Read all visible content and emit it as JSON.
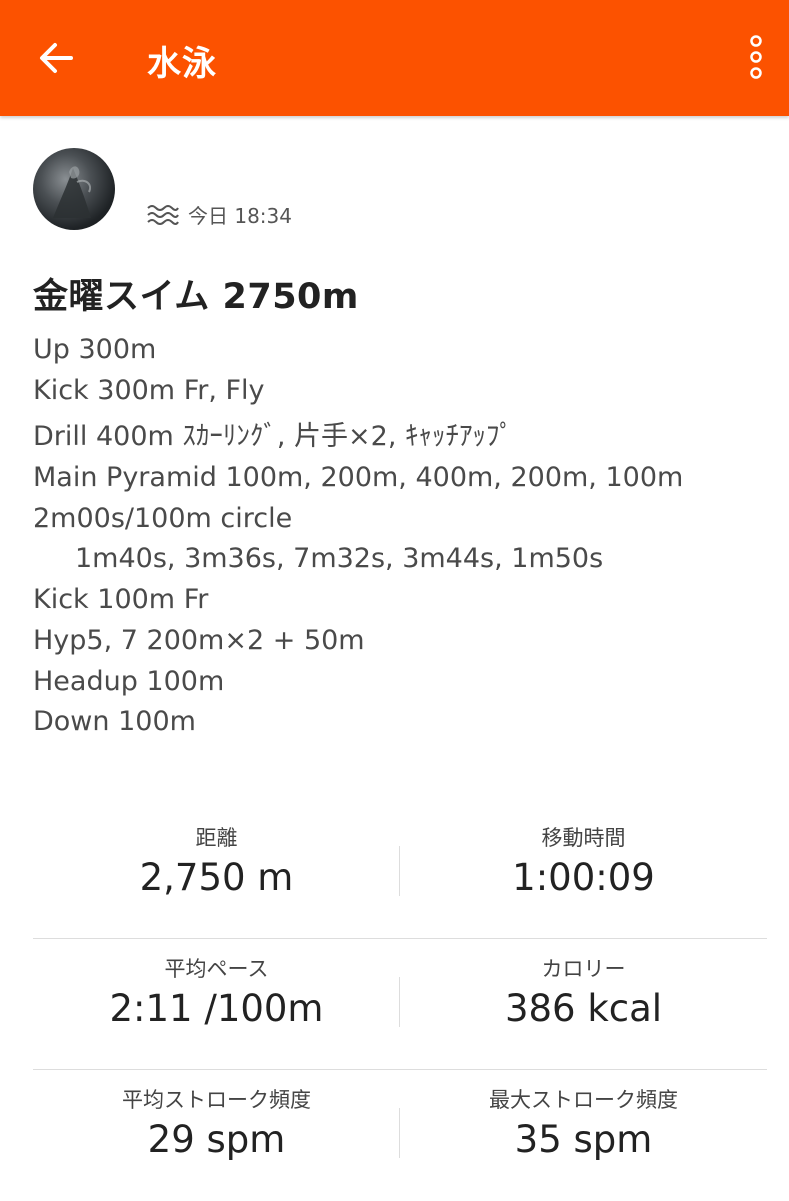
{
  "header": {
    "title": "水泳",
    "accent_color": "#fc5200",
    "back_icon": "arrow-left-icon",
    "menu_icon": "more-vertical-icon"
  },
  "activity": {
    "type_icon": "swim-waves-icon",
    "timestamp": "今日 18:34",
    "title": "金曜スイム 2750m",
    "description": [
      "Up 300m",
      "Kick 300m Fr, Fly",
      "Drill 400m ｽｶｰﾘﾝｸﾞ, 片手×2, ｷｬｯﾁｱｯﾌﾟ",
      "Main Pyramid 100m, 200m, 400m, 200m, 100m",
      "2m00s/100m circle",
      "1m40s, 3m36s, 7m32s, 3m44s, 1m50s",
      "Kick 100m Fr",
      "Hyp5, 7 200m×2 + 50m",
      "Headup 100m",
      "Down 100m"
    ]
  },
  "stats": [
    {
      "left": {
        "label": "距離",
        "value": "2,750 m"
      },
      "right": {
        "label": "移動時間",
        "value": "1:00:09"
      }
    },
    {
      "left": {
        "label": "平均ペース",
        "value": "2:11 /100m"
      },
      "right": {
        "label": "カロリー",
        "value": "386 kcal"
      }
    },
    {
      "left": {
        "label": "平均ストローク頻度",
        "value": "29 spm"
      },
      "right": {
        "label": "最大ストローク頻度",
        "value": "35 spm"
      }
    }
  ]
}
